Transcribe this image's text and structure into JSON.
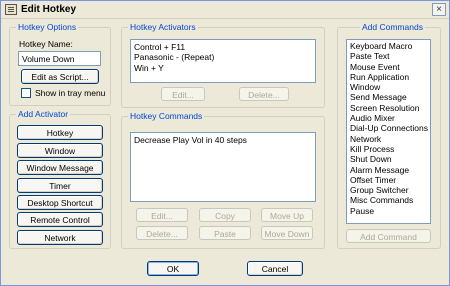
{
  "window": {
    "title": "Edit Hotkey",
    "close_symbol": "×"
  },
  "hotkey_options": {
    "legend": "Hotkey Options",
    "name_label": "Hotkey Name:",
    "name_value": "Volume Down",
    "edit_script_label": "Edit as Script...",
    "tray_label": "Show in tray menu",
    "tray_checked": false
  },
  "add_activator": {
    "legend": "Add Activator",
    "buttons": [
      "Hotkey",
      "Window",
      "Window Message",
      "Timer",
      "Desktop Shortcut",
      "Remote Control",
      "Network"
    ]
  },
  "hotkey_activators": {
    "legend": "Hotkey Activators",
    "items": [
      "Control + F11",
      "Panasonic - (Repeat)",
      "Win + Y"
    ],
    "edit_label": "Edit...",
    "delete_label": "Delete..."
  },
  "hotkey_commands": {
    "legend": "Hotkey Commands",
    "items": [
      "Decrease Play Vol in 40 steps"
    ],
    "edit_label": "Edit...",
    "copy_label": "Copy",
    "move_up_label": "Move Up",
    "delete_label": "Delete...",
    "paste_label": "Paste",
    "move_down_label": "Move Down"
  },
  "add_commands": {
    "legend": "Add Commands",
    "items": [
      "Keyboard Macro",
      "Paste Text",
      "Mouse Event",
      "Run Application",
      "Window",
      "Send Message",
      "Screen Resolution",
      "Audio Mixer",
      "Dial-Up Connections",
      "Network",
      "Kill Process",
      "Shut Down",
      "Alarm Message",
      "Offset Timer",
      "Group Switcher",
      "Misc Commands",
      "Pause"
    ],
    "add_label": "Add Command"
  },
  "footer": {
    "ok_label": "OK",
    "cancel_label": "Cancel"
  }
}
